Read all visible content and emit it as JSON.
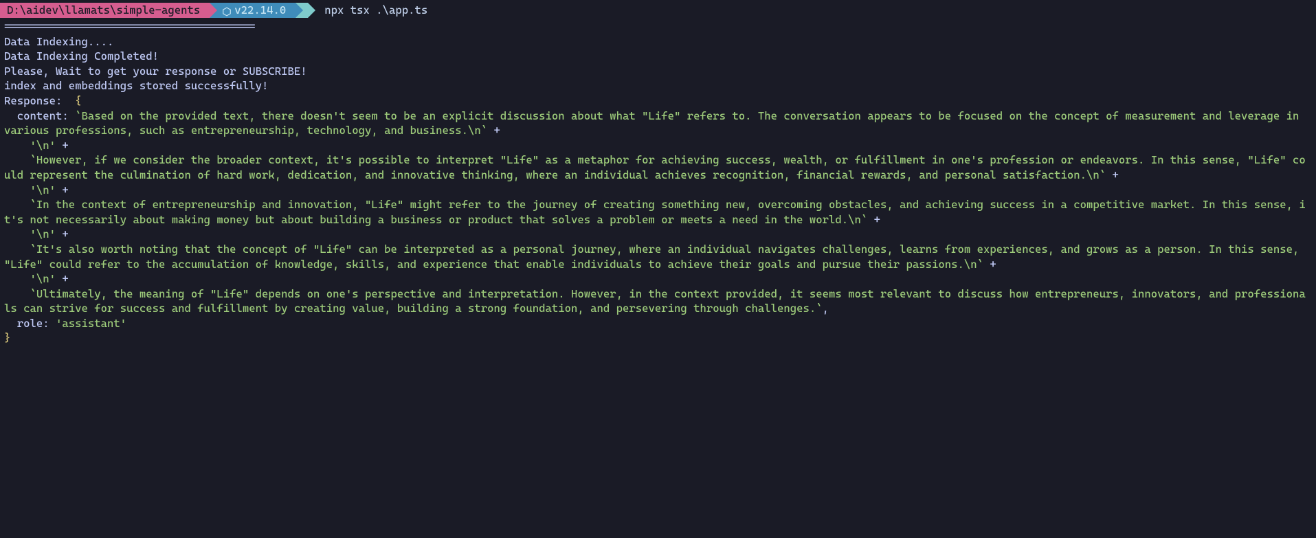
{
  "prompt": {
    "path": "D:\\aidev\\llamats\\simple-agents",
    "node_version": "v22.14.0",
    "command": "npx tsx .\\app.ts"
  },
  "output": {
    "divider": "=======================================",
    "line1": "Data Indexing....",
    "line2": "Data Indexing Completed!",
    "line3": "Please, Wait to get your response or SUBSCRIBE!",
    "line4": "index and embeddings stored successfully!",
    "response_label": "Response:  ",
    "brace_open": "{",
    "content_key": "  content: ",
    "seg1": "`Based on the provided text, there doesn't seem to be an explicit discussion about what \"Life\" refers to. The conversation appears to be focused on the concept of measurement and leverage in various professions, such as entrepreneurship, technology, and business.\\n`",
    "plus": " +",
    "nl_only": "    '\\n'",
    "seg2": "    `However, if we consider the broader context, it's possible to interpret \"Life\" as a metaphor for achieving success, wealth, or fulfillment in one's profession or endeavors. In this sense, \"Life\" could represent the culmination of hard work, dedication, and innovative thinking, where an individual achieves recognition, financial rewards, and personal satisfaction.\\n`",
    "seg3": "    `In the context of entrepreneurship and innovation, \"Life\" might refer to the journey of creating something new, overcoming obstacles, and achieving success in a competitive market. In this sense, it's not necessarily about making money but about building a business or product that solves a problem or meets a need in the world.\\n`",
    "seg4": "    `It's also worth noting that the concept of \"Life\" can be interpreted as a personal journey, where an individual navigates challenges, learns from experiences, and grows as a person. In this sense, \"Life\" could refer to the accumulation of knowledge, skills, and experience that enable individuals to achieve their goals and pursue their passions.\\n`",
    "seg5": "    `Ultimately, the meaning of \"Life\" depends on one's perspective and interpretation. However, in the context provided, it seems most relevant to discuss how entrepreneurs, innovators, and professionals can strive for success and fulfillment by creating value, building a strong foundation, and persevering through challenges.`",
    "comma": ",",
    "role_line_key": "  role: ",
    "role_line_val": "'assistant'",
    "brace_close": "}"
  }
}
